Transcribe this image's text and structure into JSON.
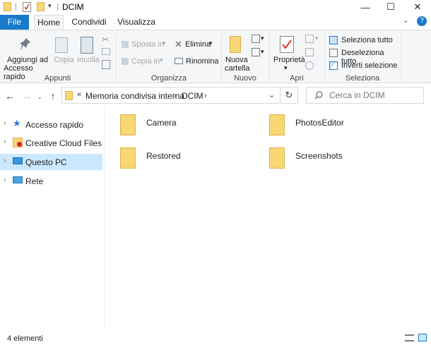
{
  "window": {
    "title": "DCIM",
    "minimize": "—",
    "maximize": "☐",
    "close": "✕"
  },
  "tabs": [
    {
      "label": "File"
    },
    {
      "label": "Home"
    },
    {
      "label": "Condividi"
    },
    {
      "label": "Visualizza"
    }
  ],
  "ribbon": {
    "clipboard": {
      "pin_line1": "Aggiungi ad",
      "pin_line2": "Accesso rapido",
      "copy": "Copia",
      "paste": "Incolla",
      "title": "Appunti"
    },
    "organize": {
      "move_to": "Sposta in",
      "copy_to": "Copia in",
      "delete": "Elimina",
      "rename": "Rinomina",
      "title": "Organizza"
    },
    "new": {
      "new_folder_line1": "Nuova",
      "new_folder_line2": "cartella",
      "title": "Nuovo"
    },
    "open": {
      "properties": "Proprietà",
      "title": "Apri"
    },
    "select": {
      "select_all": "Seleziona tutto",
      "select_none": "Deseleziona tutto",
      "invert": "Inverti selezione",
      "title": "Seleziona"
    }
  },
  "address": {
    "overflow": "«",
    "crumbs": [
      "Memoria condivisa interna",
      "DCIM"
    ],
    "separator": "›"
  },
  "search": {
    "placeholder": "Cerca in DCIM"
  },
  "sidebar": {
    "items": [
      {
        "label": "Accesso rapido"
      },
      {
        "label": "Creative Cloud Files"
      },
      {
        "label": "Questo PC"
      },
      {
        "label": "Rete"
      }
    ]
  },
  "folders": [
    {
      "name": "Camera"
    },
    {
      "name": "PhotosEditor"
    },
    {
      "name": "Restored"
    },
    {
      "name": "Screenshots"
    }
  ],
  "status": {
    "count": "4 elementi"
  },
  "colors": {
    "accent": "#1979ca",
    "selection": "#cce8ff",
    "folder": "#f8d775"
  }
}
